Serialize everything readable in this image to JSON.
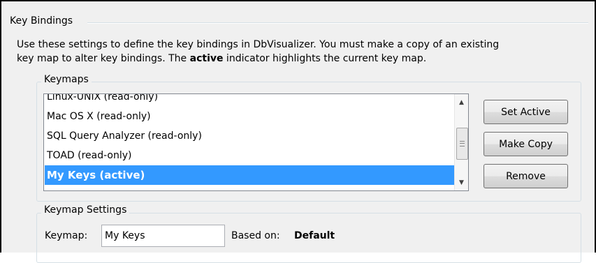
{
  "section": {
    "title": "Key Bindings",
    "description_part1": "Use these settings to define the key bindings in DbVisualizer. You must make a copy of an existing",
    "description_part2a": "key map to alter key bindings. The ",
    "description_bold": "active",
    "description_part2b": " indicator highlights the current key map."
  },
  "keymaps": {
    "title": "Keymaps",
    "items": [
      "Linux-UNIX  (read-only)",
      "Mac OS X  (read-only)",
      "SQL Query Analyzer  (read-only)",
      "TOAD  (read-only)",
      "My Keys  (active)"
    ],
    "selected_index": 4
  },
  "buttons": {
    "set_active": "Set Active",
    "make_copy": "Make Copy",
    "remove": "Remove"
  },
  "keymap_settings": {
    "title": "Keymap Settings",
    "keymap_label": "Keymap:",
    "keymap_value": "My Keys",
    "based_on_label": "Based on:",
    "based_on_value": "Default"
  }
}
